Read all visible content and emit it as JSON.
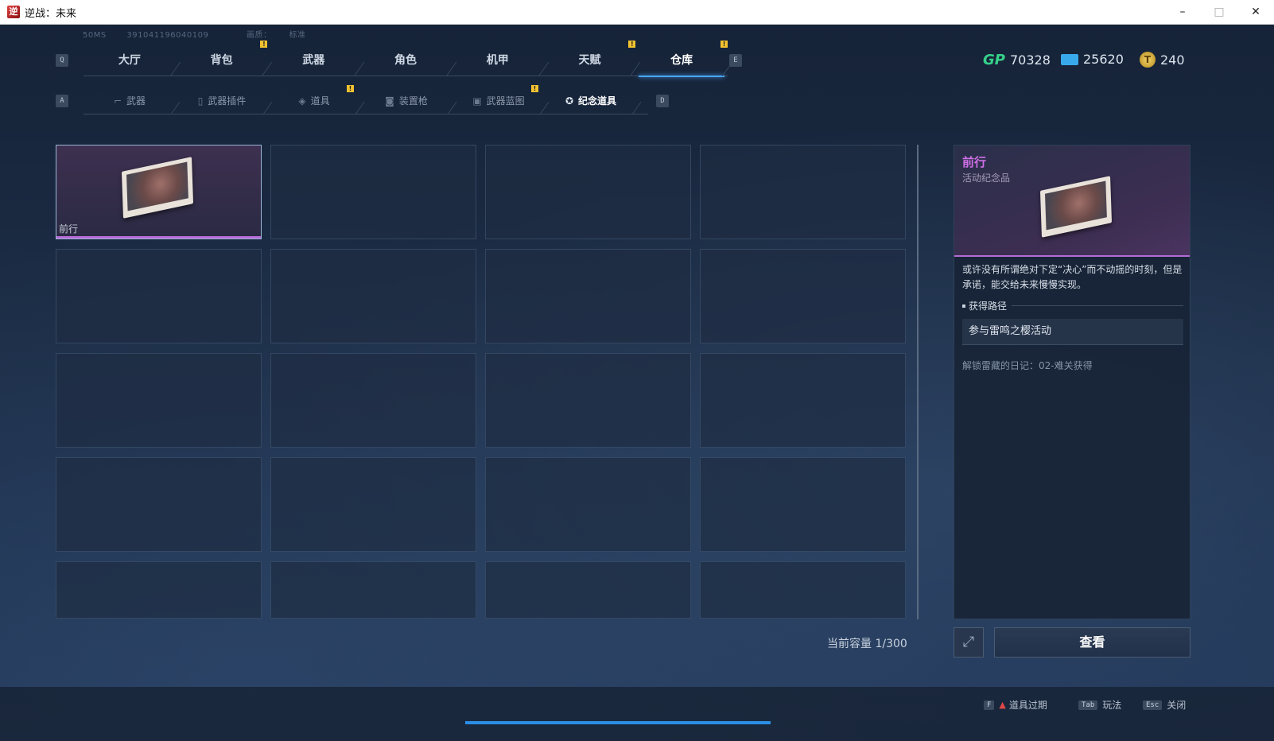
{
  "window": {
    "title": "逆战：未来",
    "controls": [
      "–",
      "□",
      "✕"
    ]
  },
  "meta": {
    "ping": "50MS",
    "server_id": "391041196040109",
    "quality_label": "画质：",
    "quality": "标准"
  },
  "keys": {
    "prev_tab": "Q",
    "next_tab": "E",
    "prev_sub": "A",
    "next_sub": "D"
  },
  "tabs": [
    {
      "label": "大厅",
      "alert": false
    },
    {
      "label": "背包",
      "alert": true
    },
    {
      "label": "武器",
      "alert": false
    },
    {
      "label": "角色",
      "alert": false
    },
    {
      "label": "机甲",
      "alert": false
    },
    {
      "label": "天赋",
      "alert": true
    },
    {
      "label": "仓库",
      "alert": true,
      "active": true
    }
  ],
  "currency": {
    "gp": "70328",
    "ticket": "25620",
    "coin": "240"
  },
  "subtabs": [
    {
      "label": "武器",
      "icon": "gun-icon",
      "alert": false
    },
    {
      "label": "武器插件",
      "icon": "attachment-icon",
      "alert": false
    },
    {
      "label": "道具",
      "icon": "item-icon",
      "alert": true
    },
    {
      "label": "装置枪",
      "icon": "device-gun-icon",
      "alert": false
    },
    {
      "label": "武器蓝图",
      "icon": "blueprint-icon",
      "alert": true
    },
    {
      "label": "纪念道具",
      "icon": "souvenir-icon",
      "alert": false,
      "active": true
    }
  ],
  "inventory": {
    "selected_item_name": "前行",
    "capacity": "当前容量 1/300"
  },
  "detail": {
    "name": "前行",
    "type": "活动纪念品",
    "description": "或许没有所谓绝对下定“决心”而不动摇的时刻，但是承诺，能交给未来慢慢实现。",
    "obtain_title": "获得路径",
    "obtain_method": "参与雷鸣之樱活动",
    "unlock_note": "解锁雷藏的日记：02-难关获得",
    "view_button": "查看"
  },
  "hints": [
    {
      "key": "F",
      "label": "道具过期"
    },
    {
      "key": "Tab",
      "label": "玩法"
    },
    {
      "key": "Esc",
      "label": "关闭"
    }
  ],
  "colors": {
    "accent": "#4aa7ff",
    "rarity": "#b46cd6",
    "alert": "#f2c230",
    "gp": "#36d18a"
  }
}
